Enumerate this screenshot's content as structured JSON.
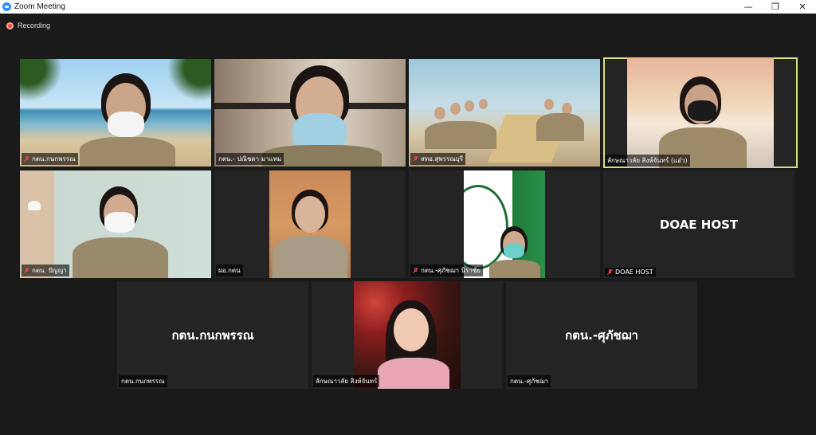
{
  "window": {
    "title": "Zoom Meeting",
    "controls": [
      "—",
      "❐",
      "✕"
    ]
  },
  "recording": {
    "label": "Recording"
  },
  "participants": [
    {
      "name": "กตน.กนกพรรณ",
      "muted": true
    },
    {
      "name": "กตน.- ปณิชดา มาแหม",
      "muted": false
    },
    {
      "name": "สทอ.สุพรรณบุรี",
      "muted": true
    },
    {
      "name": "ลักษณาวลัย สิงห์จันทร์ (แอ๋ว)",
      "muted": false
    },
    {
      "name": "กตน. ปัญญา",
      "muted": true
    },
    {
      "name": "ผอ.กตน",
      "muted": false
    },
    {
      "name": "กตน.-ศุภัชฌา นิราชัย",
      "muted": true
    },
    {
      "name": "DOAE HOST",
      "display": "DOAE HOST",
      "muted": true
    },
    {
      "name": "กตน.กนกพรรณ",
      "display": "กตน.กนกพรรณ",
      "muted": false
    },
    {
      "name": "ลักษณาวลัย สิงห์จันทร์",
      "muted": false
    },
    {
      "name": "กตน.-ศุภัชฌา",
      "display": "กตน.-ศุภัชฌา",
      "muted": false
    }
  ],
  "colors": {
    "active_border": "#d8e07a",
    "muted_icon": "#ff4d4d",
    "recording": "#e8533c"
  }
}
